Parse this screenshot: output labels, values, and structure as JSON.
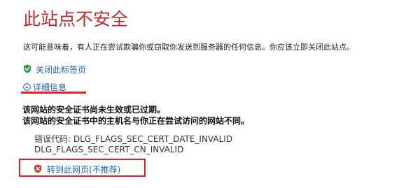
{
  "page": {
    "title": "此站点不安全",
    "description": "这可能意味着，有人正在尝试欺骗你或窃取你发送到服务器的任何信息。你应该立即关闭此站点。"
  },
  "actions": {
    "close_tab_label": "关闭此标签页",
    "details_label": "详细信息",
    "proceed_label": "转到此网页(不推荐)"
  },
  "details": {
    "messages": [
      "该网站的安全证书尚未生效或已过期。",
      "该网站的安全证书中的主机名与你正在尝试访问的网站不同。"
    ],
    "error_code_label": "错误代码:",
    "error_codes": [
      "DLG_FLAGS_SEC_CERT_DATE_INVALID",
      "DLG_FLAGS_SEC_CERT_CN_INVALID"
    ]
  },
  "icons": {
    "close_tab": "green-shield-check-icon",
    "details": "collapse-arrow-icon",
    "proceed": "red-shield-x-icon"
  },
  "colors": {
    "title": "#c0282d",
    "link": "#1a5fb4",
    "highlight": "#e21f26",
    "shield_green": "#2e9e3b",
    "shield_red": "#d32f2f"
  }
}
